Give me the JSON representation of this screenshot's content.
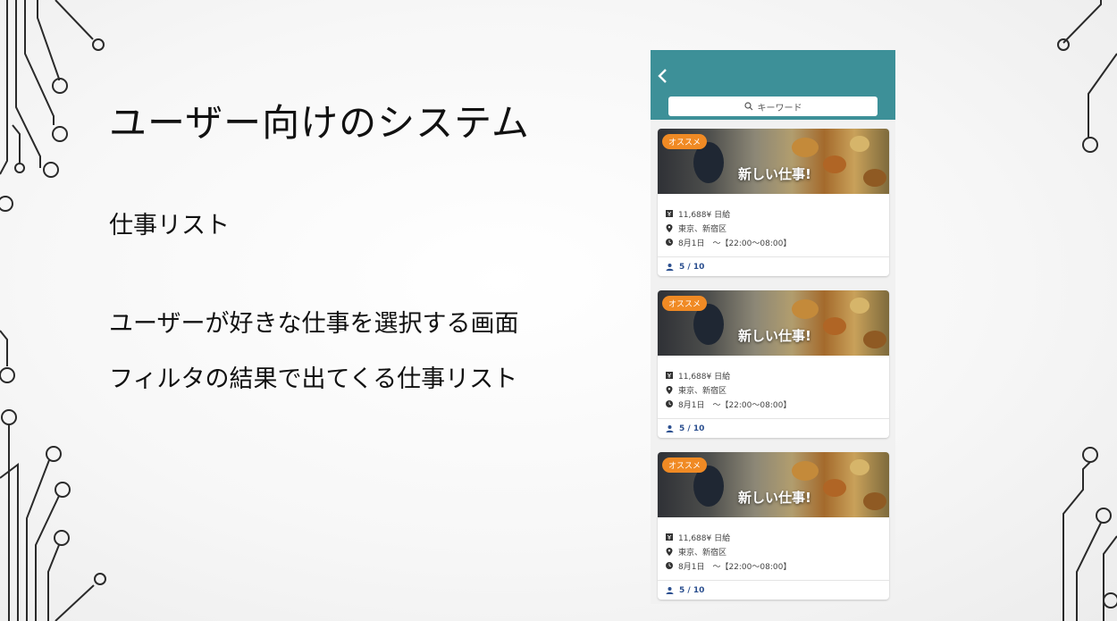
{
  "slide": {
    "title": "ユーザー向けのシステム",
    "subtitle": "仕事リスト",
    "bullets": [
      "ユーザーが好きな仕事を選択する画面",
      "フィルタの結果で出てくる仕事リスト"
    ]
  },
  "app": {
    "header_color": "#3d9098",
    "search": {
      "placeholder": "キーワード"
    },
    "jobs": [
      {
        "badge": "オススメ",
        "title": "新しい仕事!",
        "wage": "11,688¥ 日給",
        "location": "東京、新宿区",
        "schedule": "8月1日　～【22:00～08:00】",
        "capacity": "5 / 10"
      },
      {
        "badge": "オススメ",
        "title": "新しい仕事!",
        "wage": "11,688¥ 日給",
        "location": "東京、新宿区",
        "schedule": "8月1日　～【22:00～08:00】",
        "capacity": "5 / 10"
      },
      {
        "badge": "オススメ",
        "title": "新しい仕事!",
        "wage": "11,688¥ 日給",
        "location": "東京、新宿区",
        "schedule": "8月1日　～【22:00～08:00】",
        "capacity": "5 / 10"
      }
    ],
    "badge_color": "#f08a24"
  }
}
